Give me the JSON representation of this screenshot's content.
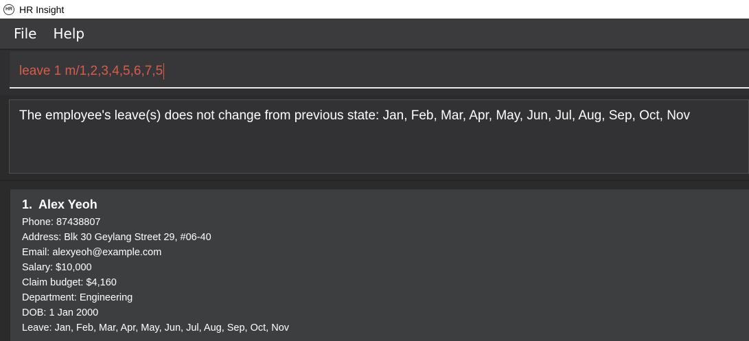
{
  "window": {
    "title": "HR Insight",
    "icon": "HR"
  },
  "menu": {
    "items": [
      "File",
      "Help"
    ]
  },
  "command": {
    "value": "leave 1 m/1,2,3,4,5,6,7,5"
  },
  "result": {
    "message": "The employee's leave(s) does not change from previous state: Jan, Feb, Mar, Apr, May, Jun, Jul, Aug, Sep, Oct, Nov"
  },
  "employees": [
    {
      "index": "1.",
      "name": "Alex Yeoh",
      "phone": "Phone: 87438807",
      "address": "Address: Blk 30 Geylang Street 29, #06-40",
      "email": "Email: alexyeoh@example.com",
      "salary": "Salary: $10,000",
      "claim_budget": "Claim budget: $4,160",
      "department": "Department: Engineering",
      "dob": "DOB: 1 Jan 2000",
      "leave": "Leave: Jan, Feb, Mar, Apr, May, Jun, Jul, Aug, Sep, Oct, Nov"
    }
  ],
  "colors": {
    "command_text": "#d95c4a",
    "background": "#2b2b2b",
    "card": "#3c3e3f"
  }
}
